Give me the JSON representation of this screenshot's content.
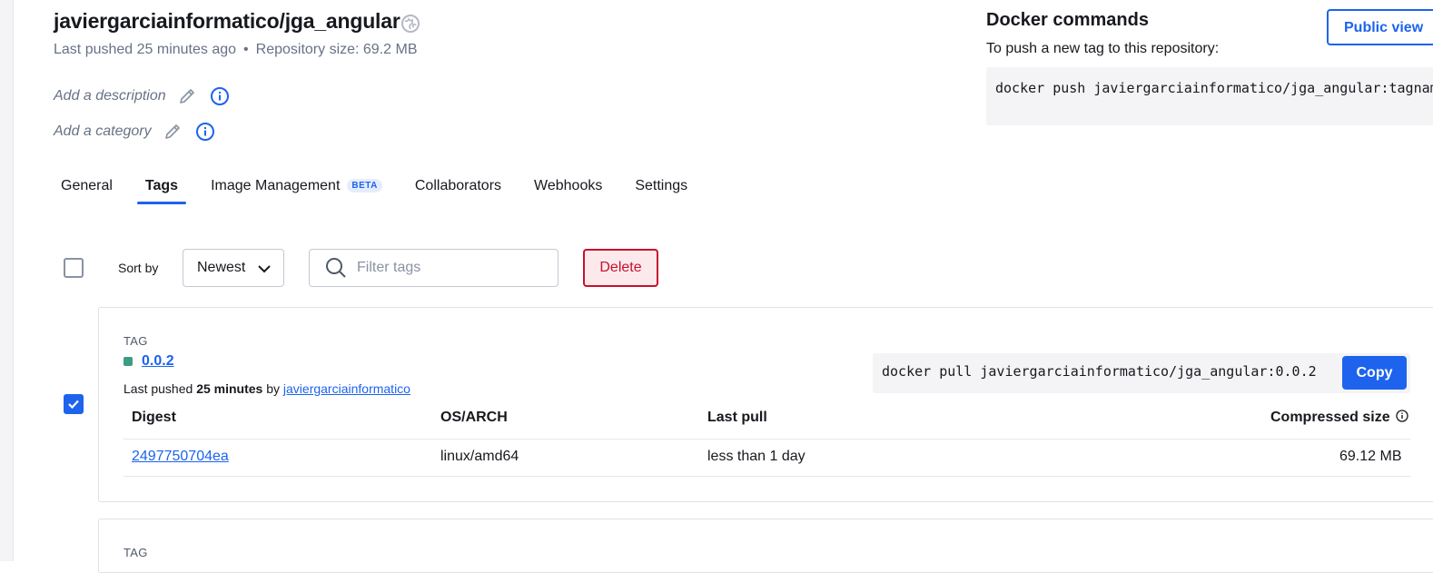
{
  "repo": {
    "title": "javiergarciainformatico/jga_angular",
    "last_pushed": "Last pushed 25 minutes ago",
    "separator": "•",
    "size": "Repository size: 69.2 MB",
    "add_description": "Add a description",
    "add_category": "Add a category"
  },
  "docker": {
    "heading": "Docker commands",
    "subheading": "To push a new tag to this repository:",
    "push_command": "docker push javiergarciainformatico/jga_angular:tagname",
    "public_view": "Public view"
  },
  "tabs": [
    {
      "label": "General",
      "active": false
    },
    {
      "label": "Tags",
      "active": true
    },
    {
      "label": "Image Management",
      "badge": "BETA",
      "active": false
    },
    {
      "label": "Collaborators",
      "active": false
    },
    {
      "label": "Webhooks",
      "active": false
    },
    {
      "label": "Settings",
      "active": false
    }
  ],
  "toolbar": {
    "sort_label": "Sort by",
    "sort_value": "Newest",
    "filter_placeholder": "Filter tags",
    "delete_label": "Delete"
  },
  "tags": [
    {
      "label": "TAG",
      "name": "0.0.2",
      "status_color": "#3c9c84",
      "pushed_prefix": "Last pushed",
      "pushed_time": "25 minutes",
      "pushed_by_text": "by",
      "pushed_by": "javiergarciainformatico",
      "pull_command": "docker pull javiergarciainformatico/jga_angular:0.0.2",
      "copy_label": "Copy",
      "columns": [
        "Digest",
        "OS/ARCH",
        "Last pull",
        "Compressed size"
      ],
      "rows": [
        {
          "digest": "2497750704ea",
          "os_arch": "linux/amd64",
          "last_pull": "less than 1 day",
          "size": "69.12 MB"
        }
      ],
      "checked": true
    },
    {
      "label": "TAG"
    }
  ],
  "colors": {
    "accent": "#1d63ed",
    "danger": "#c8102e",
    "status_green": "#3c9c84"
  }
}
